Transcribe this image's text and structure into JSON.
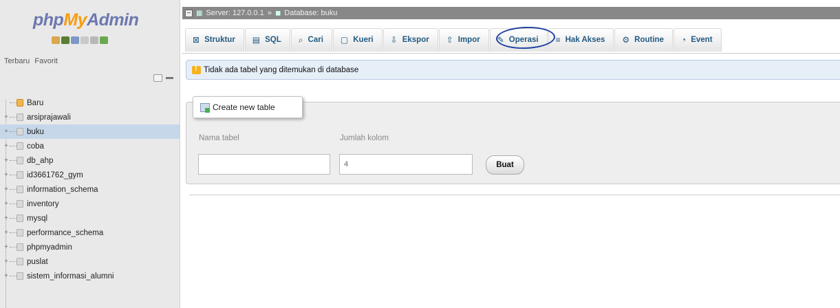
{
  "app": {
    "logo_php": "php",
    "logo_my": "My",
    "logo_admin": "Admin"
  },
  "sidebar": {
    "recent_label": "Terbaru",
    "favorites_label": "Favorit",
    "new_label": "Baru",
    "databases": [
      {
        "label": "arsiprajawali",
        "selected": false
      },
      {
        "label": "buku",
        "selected": true
      },
      {
        "label": "coba",
        "selected": false
      },
      {
        "label": "db_ahp",
        "selected": false
      },
      {
        "label": "id3661762_gym",
        "selected": false
      },
      {
        "label": "information_schema",
        "selected": false
      },
      {
        "label": "inventory",
        "selected": false
      },
      {
        "label": "mysql",
        "selected": false
      },
      {
        "label": "performance_schema",
        "selected": false
      },
      {
        "label": "phpmyadmin",
        "selected": false
      },
      {
        "label": "puslat",
        "selected": false
      },
      {
        "label": "sistem_informasi_alumni",
        "selected": false
      }
    ]
  },
  "breadcrumb": {
    "server": "Server: 127.0.0.1",
    "separator": "»",
    "database": "Database: buku"
  },
  "tabs": [
    {
      "label": "Struktur",
      "icon": "structure-icon"
    },
    {
      "label": "SQL",
      "icon": "sql-icon"
    },
    {
      "label": "Cari",
      "icon": "search-icon"
    },
    {
      "label": "Kueri",
      "icon": "query-icon"
    },
    {
      "label": "Ekspor",
      "icon": "export-icon"
    },
    {
      "label": "Impor",
      "icon": "import-icon"
    },
    {
      "label": "Operasi",
      "icon": "wrench-icon"
    },
    {
      "label": "Hak Akses",
      "icon": "privileges-icon"
    },
    {
      "label": "Routine",
      "icon": "routine-icon"
    },
    {
      "label": "Event",
      "icon": "event-icon"
    }
  ],
  "notice": {
    "text": "Tidak ada tabel yang ditemukan di database"
  },
  "create_table": {
    "legend": "Create new table",
    "name_label": "Nama tabel",
    "name_value": "",
    "columns_label": "Jumlah kolom",
    "columns_value": "4",
    "submit_label": "Buat"
  },
  "colors": {
    "accent": "#235a81",
    "circle_annotation": "#2040a0",
    "selected_row": "#c6d7e9"
  }
}
